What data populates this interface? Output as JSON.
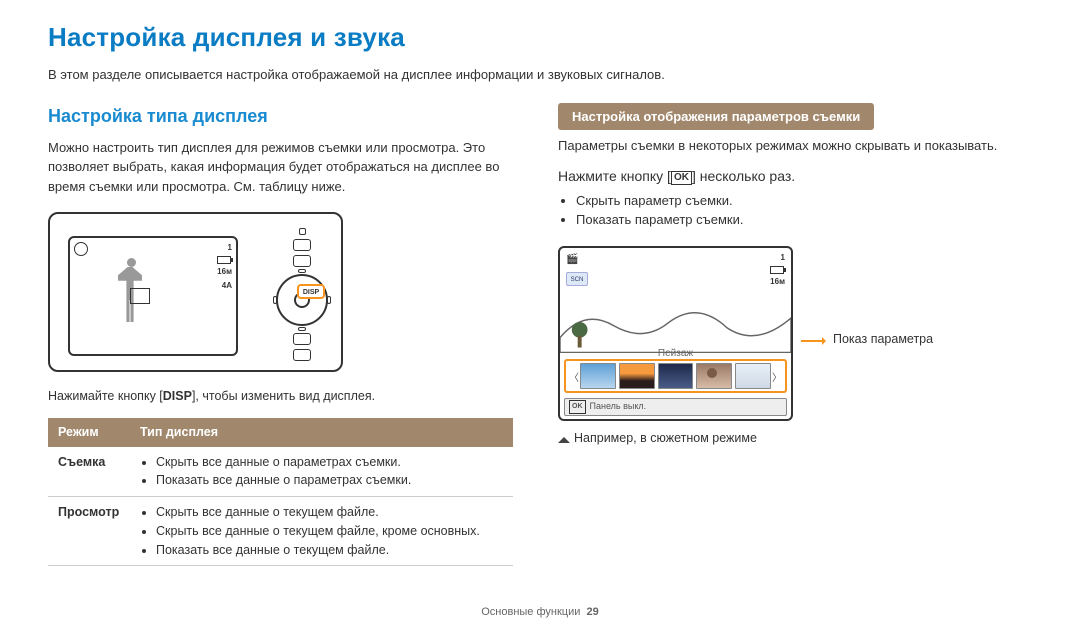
{
  "title": "Настройка дисплея и звука",
  "intro": "В этом разделе описывается настройка отображаемой на дисплее информации и звуковых сигналов.",
  "left": {
    "heading": "Настройка типа дисплея",
    "para": "Можно настроить тип дисплея для режимов съемки или просмотра. Это позволяет выбрать, какая информация будет отображаться на дисплее во время съемки или просмотра. См. таблицу ниже.",
    "hint_pre": "Нажимайте кнопку [",
    "hint_btn": "DISP",
    "hint_post": "], чтобы изменить вид дисплея.",
    "lcd_count": "1",
    "lcd_res": "16м",
    "lcd_flash": "4A",
    "disp_label": "DISP"
  },
  "table": {
    "h1": "Режим",
    "h2": "Тип дисплея",
    "r1": {
      "mode": "Съемка",
      "a": "Скрыть все данные о параметрах съемки.",
      "b": "Показать все данные о параметрах съемки."
    },
    "r2": {
      "mode": "Просмотр",
      "a": "Скрыть все данные о текущем файле.",
      "b": "Скрыть все данные о текущем файле, кроме основных.",
      "c": "Показать все данные о текущем файле."
    }
  },
  "right": {
    "pill": "Настройка отображения параметров съемки",
    "para": "Параметры съемки в некоторых режимах можно скрывать и показывать.",
    "instr_pre": "Нажмите кнопку [",
    "ok": "OK",
    "instr_post": "] несколько раз.",
    "b1": "Скрыть параметр съемки.",
    "b2": "Показать параметр съемки.",
    "scene_label": "Пейзаж",
    "scn_tag": "SCN",
    "count": "1",
    "res": "16м",
    "panel_ok": "OK",
    "panel_off": "Панель выкл.",
    "callout": "Показ параметра",
    "caption": "Например, в сюжетном режиме"
  },
  "footer": {
    "section": "Основные функции",
    "page": "29"
  }
}
